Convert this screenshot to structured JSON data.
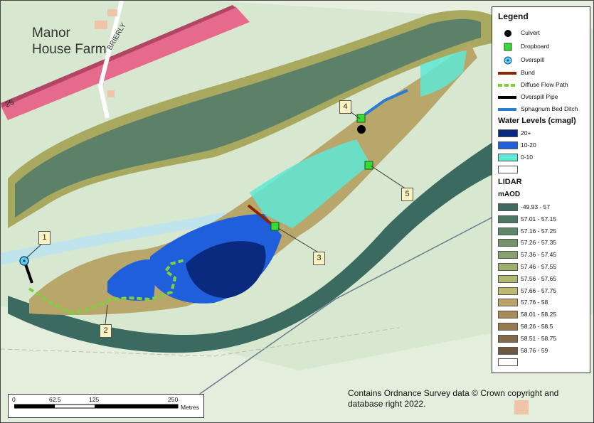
{
  "place_label": "Manor\nHouse Farm",
  "road_labels": {
    "brierly": "BRIERLY",
    "road_25": "25"
  },
  "callouts": [
    "1",
    "2",
    "3",
    "4",
    "5"
  ],
  "legend": {
    "title": "Legend",
    "point_items": [
      {
        "label": "Culvert",
        "icon": "black-circle"
      },
      {
        "label": "Dropboard",
        "icon": "green-square"
      },
      {
        "label": "Overspill",
        "icon": "cyan-circle-dot"
      }
    ],
    "line_items": [
      {
        "label": "Bund",
        "color": "#8b2500"
      },
      {
        "label": "Diffuse Flow Path",
        "color": "#7fd13b"
      },
      {
        "label": "Overspill Pipe",
        "color": "#000000"
      },
      {
        "label": "Sphagnum Bed Ditch",
        "color": "#2b7bd4"
      }
    ],
    "water_title": "Water Levels (cmagl)",
    "water_items": [
      {
        "label": "20+",
        "color": "#0a2a80"
      },
      {
        "label": "10-20",
        "color": "#1f5fdc"
      },
      {
        "label": "0-10",
        "color": "#5ee8d6"
      },
      {
        "label": "",
        "color": "#ffffff"
      }
    ],
    "lidar_title": "LIDAR",
    "lidar_unit": "mAOD",
    "lidar_items": [
      {
        "label": "-49.93 - 57",
        "color": "#3f6b62"
      },
      {
        "label": "57.01 - 57.15",
        "color": "#4e7764"
      },
      {
        "label": "57.16 - 57.25",
        "color": "#5e8766"
      },
      {
        "label": "57.26 - 57.35",
        "color": "#73946a"
      },
      {
        "label": "57.36 - 57.45",
        "color": "#88a26c"
      },
      {
        "label": "57.46 - 57.55",
        "color": "#9cb06e"
      },
      {
        "label": "57.56 - 57.65",
        "color": "#b0b96f"
      },
      {
        "label": "57.66 - 57.75",
        "color": "#bfb86e"
      },
      {
        "label": "57.76 - 58",
        "color": "#bca466"
      },
      {
        "label": "58.01 - 58.25",
        "color": "#a88c57"
      },
      {
        "label": "58.26 - 58.5",
        "color": "#957a4e"
      },
      {
        "label": "58.51 - 58.75",
        "color": "#826a48"
      },
      {
        "label": "58.76 - 59",
        "color": "#6e5740"
      },
      {
        "label": "",
        "color": "#ffffff"
      }
    ]
  },
  "scalebar": {
    "ticks": [
      "0",
      "62.5",
      "125",
      "250"
    ],
    "unit": "Metres"
  },
  "copyright": "Contains Ordnance Survey data © Crown copyright and database right 2022."
}
